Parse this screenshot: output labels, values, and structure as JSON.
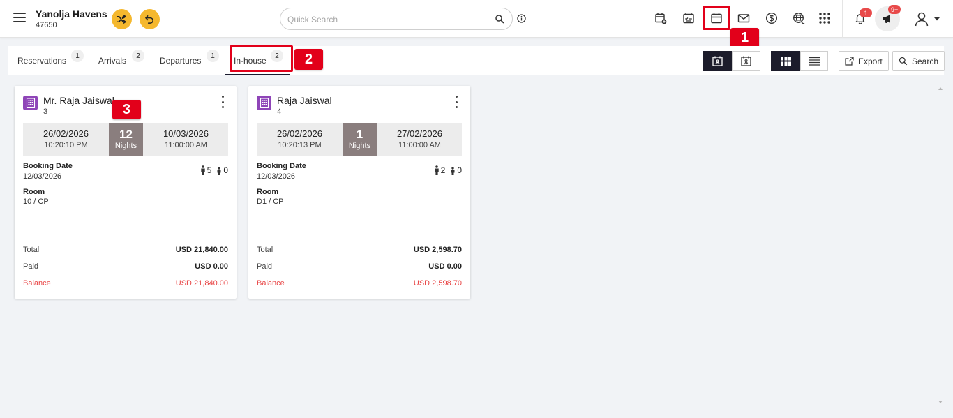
{
  "header": {
    "hotel_name": "Yanolja Havens",
    "hotel_id": "47650",
    "search_placeholder": "Quick Search",
    "notification_count": "1",
    "announcement_count": "9+",
    "icons": [
      "calendar-plus-icon",
      "calendar-check-icon",
      "calendar-icon",
      "mail-icon",
      "dollar-icon",
      "globe-icon",
      "apps-grid-icon",
      "bell-icon",
      "megaphone-icon",
      "user-icon"
    ]
  },
  "annotations": {
    "step1": "1",
    "step2": "2",
    "step3": "3"
  },
  "tabs": [
    {
      "label": "Reservations",
      "count": "1"
    },
    {
      "label": "Arrivals",
      "count": "2"
    },
    {
      "label": "Departures",
      "count": "1"
    },
    {
      "label": "In-house",
      "count": "2"
    }
  ],
  "toolbar": {
    "export_label": "Export",
    "search_label": "Search"
  },
  "labels": {
    "booking_date": "Booking Date",
    "room": "Room",
    "total": "Total",
    "paid": "Paid",
    "balance": "Balance",
    "nights": "Nights"
  },
  "cards": [
    {
      "guest": "Mr. Raja Jaiswal",
      "reservation_no": "3",
      "arrival_date": "26/02/2026",
      "arrival_time": "10:20:10 PM",
      "nights": "12",
      "departure_date": "10/03/2026",
      "departure_time": "11:00:00 AM",
      "booking_date": "12/03/2026",
      "adults": "5",
      "children": "0",
      "room": "10 / CP",
      "total": "USD 21,840.00",
      "paid": "USD 0.00",
      "balance": "USD 21,840.00"
    },
    {
      "guest": "Raja Jaiswal",
      "reservation_no": "4",
      "arrival_date": "26/02/2026",
      "arrival_time": "10:20:13 PM",
      "nights": "1",
      "departure_date": "27/02/2026",
      "departure_time": "11:00:00 AM",
      "booking_date": "12/03/2026",
      "adults": "2",
      "children": "0",
      "room": "D1 / CP",
      "total": "USD 2,598.70",
      "paid": "USD 0.00",
      "balance": "USD 2,598.70"
    }
  ],
  "colors": {
    "accent": "#f5b82e",
    "highlight": "#e2001a",
    "dark": "#1c1c2b",
    "balance": "#e84545",
    "nights_bg": "#8a7e7e",
    "building_icon": "#8f45b8"
  }
}
